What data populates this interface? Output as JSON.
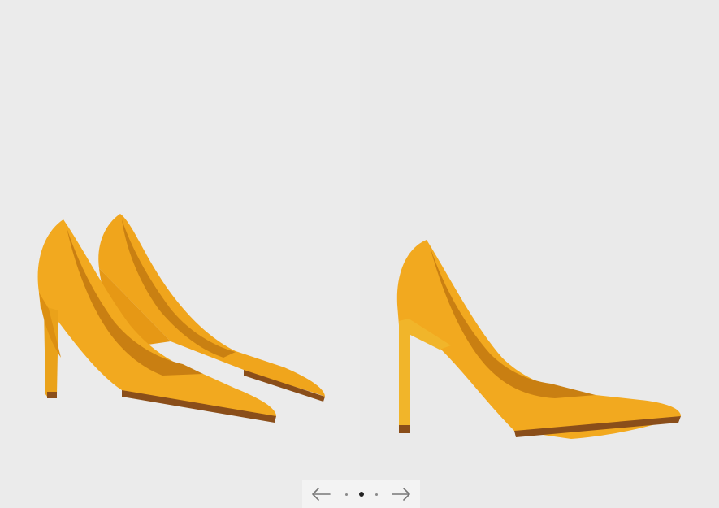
{
  "gallery": {
    "images": [
      {
        "name": "pair-of-yellow-pumps",
        "alt": ""
      },
      {
        "name": "single-yellow-pump-side-view",
        "alt": ""
      }
    ],
    "pager": {
      "prev_icon": "arrow-left-icon",
      "next_icon": "arrow-right-icon",
      "total_dots": 3,
      "active_dot": 2
    }
  },
  "colors": {
    "background": "#ebebeb",
    "shoe_main": "#f2a91f",
    "shoe_shadow": "#d98c10",
    "shoe_inner": "#c97f12",
    "sole": "#8a4e1a",
    "pager_bg": "#f3f3f3",
    "arrow": "#777777",
    "dot_active": "#222222",
    "dot_inactive": "#8a8a8a"
  }
}
